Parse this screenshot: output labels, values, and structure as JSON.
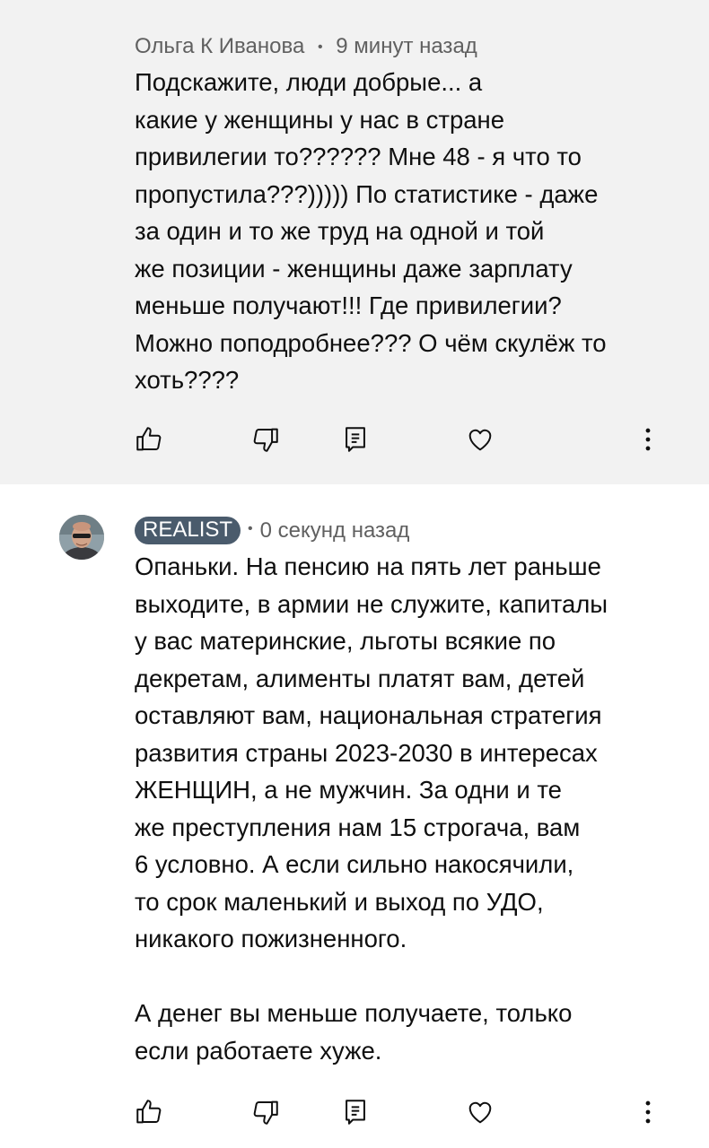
{
  "comments": [
    {
      "author": "Ольга К Иванова",
      "separator": "•",
      "time": "9 минут назад",
      "lines": [
        "Подскажите, люди добрые... а",
        "какие у женщины у нас в стране",
        "привилегии то?????? Мне 48 - я что то",
        "пропустила???))))) По статистике - даже",
        "за один и то же труд на одной и той",
        "же позиции - женщины даже зарплату",
        "меньше получают!!! Где привилегии?",
        "Можно поподробнее??? О чём скулёж то",
        "хоть????"
      ],
      "actions": [
        "like-icon",
        "dislike-icon",
        "reply-icon",
        "heart-icon",
        "more-icon"
      ]
    },
    {
      "author": "REALIST",
      "separator": "•",
      "time": "0 секунд назад",
      "avatar_icon": "user-avatar",
      "lines": [
        "Опаньки. На пенсию на пять лет раньше",
        "выходите, в армии не служите, капиталы",
        "у вас материнские, льготы всякие по",
        "декретам, алименты платят вам, детей",
        "оставляют вам, национальная стратегия",
        "развития страны 2023-2030  в интересах",
        "ЖЕНЩИН, а не мужчин. За одни и те",
        "же преступления нам 15 строгача, вам",
        "6 условно. А если сильно накосячили,",
        "то срок маленький и выход по УДО,",
        "никакого пожизненного."
      ],
      "lines_after_gap": [
        "А денег вы меньше получаете, только",
        "если работаете хуже."
      ],
      "actions": [
        "like-icon",
        "dislike-icon",
        "reply-icon",
        "heart-icon",
        "more-icon"
      ]
    }
  ],
  "colors": {
    "first_comment_bg": "#f2f2f2",
    "badge_bg": "#4a5b6c",
    "meta_text": "#606060",
    "body_text": "#0f0f0f"
  }
}
